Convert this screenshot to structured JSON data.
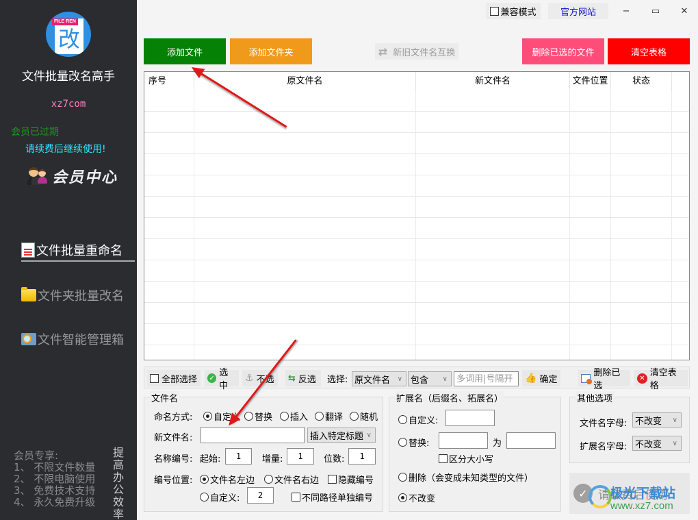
{
  "sidebar": {
    "logo_tag": "FILE REN",
    "logo_glyph": "改",
    "app_title": "文件批量改名高手",
    "site": "xz7com",
    "membership_status": "会员已过期",
    "renew_prompt": "请续费后继续使用!",
    "member_center": "会员中心",
    "nav": [
      {
        "label": "文件批量重命名",
        "icon": "document-list-icon",
        "active": true
      },
      {
        "label": "文件夹批量改名",
        "icon": "folder-icon",
        "active": false
      },
      {
        "label": "文件智能管理箱",
        "icon": "image-search-icon",
        "active": false
      }
    ],
    "perks_title": "会员专享:",
    "perks": [
      "1、 不限文件数量",
      "2、 不限电脑使用",
      "3、 免费技术支持",
      "4、 永久免费升级"
    ],
    "slogan": "提高办公效率"
  },
  "topbar": {
    "compat_mode": {
      "label": "兼容模式",
      "checked": false
    },
    "official_site": "官方网站",
    "window_controls": {
      "minimize": "−",
      "maximize": "▭",
      "close": "✕"
    }
  },
  "actions": {
    "add_file": "添加文件",
    "add_folder": "添加文件夹",
    "swap_names": "新旧文件名互换",
    "delete_selected_files": "删除已选的文件",
    "clear_table": "清空表格",
    "colors": {
      "add_file": "#058205",
      "add_folder": "#f09a1c",
      "delete_selected": "#ff4d79",
      "clear_table": "#ff0000"
    }
  },
  "table": {
    "columns": [
      "序号",
      "原文件名",
      "新文件名",
      "文件位置",
      "状态",
      ""
    ],
    "rows": []
  },
  "selection_bar": {
    "select_all": {
      "label": "全部选择",
      "checked": false
    },
    "select": "选中",
    "deselect": "不选",
    "invert": "反选",
    "filter_label": "选择:",
    "filter_field": "原文件名",
    "filter_mode": "包含",
    "keyword_placeholder": "多词用|号隔开",
    "keyword_value": "",
    "confirm": "确定",
    "delete_selected": "删除已选",
    "clear_table": "清空表格"
  },
  "filename_group": {
    "title": "文件名",
    "mode_label": "命名方式:",
    "modes": [
      {
        "label": "自定义",
        "checked": true
      },
      {
        "label": "替换",
        "checked": false
      },
      {
        "label": "插入",
        "checked": false
      },
      {
        "label": "翻译",
        "checked": false
      },
      {
        "label": "随机",
        "checked": false
      }
    ],
    "new_name_label": "新文件名:",
    "new_name_value": "",
    "insert_title": "插入特定标题",
    "numbering_label": "名称编号:",
    "start_label": "起始:",
    "start_value": "1",
    "step_label": "增量:",
    "step_value": "1",
    "digits_label": "位数:",
    "digits_value": "1",
    "position_label": "编号位置:",
    "positions": [
      {
        "label": "文件名左边",
        "checked": true
      },
      {
        "label": "文件名右边",
        "checked": false
      }
    ],
    "hide_number": {
      "label": "隐藏编号",
      "checked": false
    },
    "custom_position": {
      "label": "自定义:",
      "checked": false,
      "value": "2"
    },
    "per_path_numbering": {
      "label": "不同路径单独编号",
      "checked": false
    }
  },
  "extension_group": {
    "title": "扩展名（后缀名、拓展名）",
    "custom": {
      "label": "自定义:",
      "checked": false,
      "value": ""
    },
    "replace": {
      "label": "替换:",
      "checked": false,
      "from": "",
      "to_label": "为",
      "to": ""
    },
    "case_sensitive": {
      "label": "区分大小写",
      "checked": false
    },
    "delete": {
      "label": "删除（会变成未知类型的文件）",
      "checked": false
    },
    "unchanged": {
      "label": "不改变",
      "checked": true
    }
  },
  "other_group": {
    "title": "其他选项",
    "filename_case_label": "文件名字母:",
    "filename_case_value": "不改变",
    "ext_case_label": "扩展名字母:",
    "ext_case_value": "不改变"
  },
  "run_button": "请续费后使用",
  "watermark": {
    "name": "极光下载站",
    "url": "www.xz7.com"
  }
}
